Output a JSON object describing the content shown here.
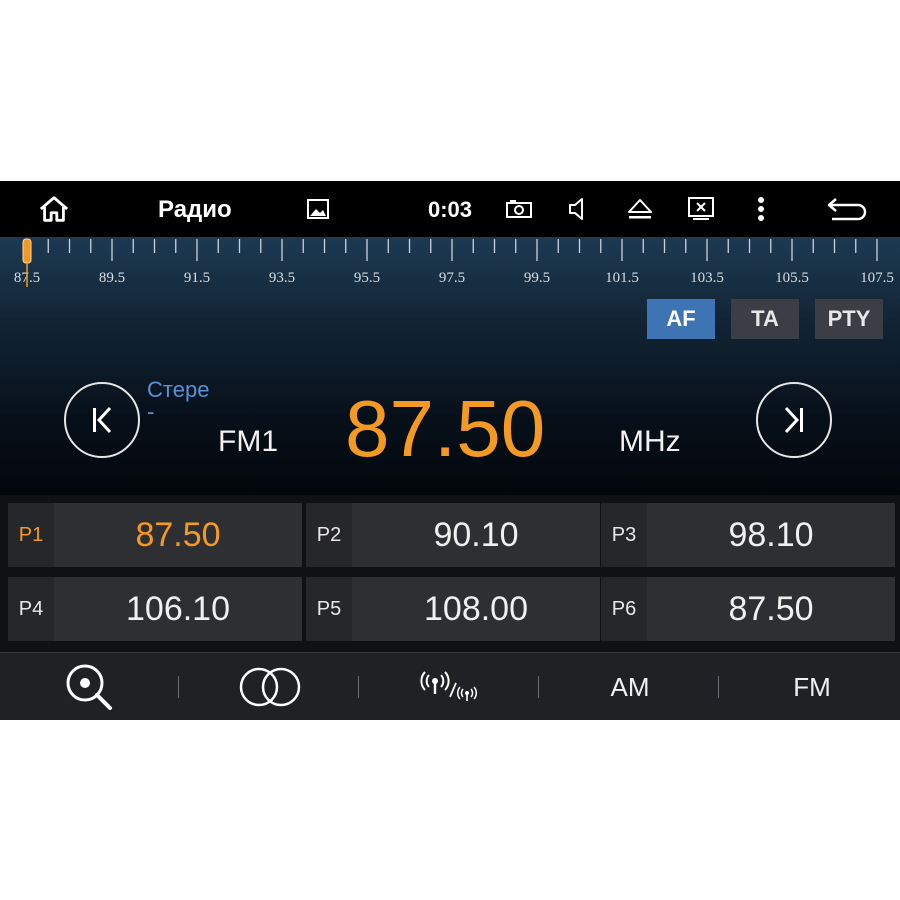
{
  "status_bar": {
    "title": "Радио",
    "time": "0:03",
    "icons": [
      "home-icon",
      "gallery-icon",
      "screenshot-icon",
      "volume-icon",
      "eject-icon",
      "screen-off-icon",
      "more-vert-icon",
      "back-icon"
    ]
  },
  "tuner": {
    "scale_labels": [
      "87.5",
      "89.5",
      "91.5",
      "93.5",
      "95.5",
      "97.5",
      "99.5",
      "101.5",
      "103.5",
      "105.5",
      "107.5"
    ],
    "scale_min": 87.5,
    "scale_max": 107.5,
    "current_position": 87.5,
    "modes": [
      {
        "label": "AF",
        "active": true
      },
      {
        "label": "TA",
        "active": false
      },
      {
        "label": "PTY",
        "active": false
      }
    ],
    "stereo_label": "Стере\n-",
    "band": "FM1",
    "frequency": "87.50",
    "unit": "MHz",
    "accent_color": "#f49a22",
    "active_mode_color": "#3f74b4"
  },
  "presets": [
    {
      "label": "P1",
      "value": "87.50",
      "active": true
    },
    {
      "label": "P2",
      "value": "90.10",
      "active": false
    },
    {
      "label": "P3",
      "value": "98.10",
      "active": false
    },
    {
      "label": "P4",
      "value": "106.10",
      "active": false
    },
    {
      "label": "P5",
      "value": "108.00",
      "active": false
    },
    {
      "label": "P6",
      "value": "87.50",
      "active": false
    }
  ],
  "bottom_bar": {
    "icons": [
      "search-scan-icon",
      "stereo-icon",
      "local-distance-icon"
    ],
    "am_label": "AM",
    "fm_label": "FM"
  }
}
